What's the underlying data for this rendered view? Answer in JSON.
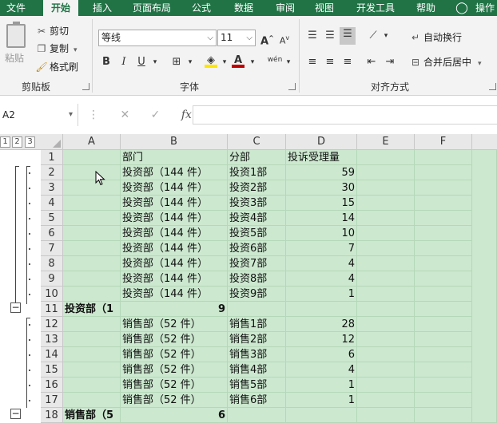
{
  "ribbon_tabs": [
    "文件",
    "开始",
    "插入",
    "页面布局",
    "公式",
    "数据",
    "审阅",
    "视图",
    "开发工具",
    "帮助",
    "操作"
  ],
  "active_tab": "开始",
  "clipboard": {
    "paste_label": "粘贴",
    "cut_label": "剪切",
    "copy_label": "复制",
    "format_painter_label": "格式刷",
    "group_label": "剪贴板"
  },
  "font": {
    "font_name": "等线",
    "font_size": "11",
    "group_label": "字体",
    "bold": "B",
    "italic": "I",
    "underline": "U",
    "grow": "A",
    "shrink": "A",
    "phonetic": "wén"
  },
  "alignment": {
    "wrap_label": "自动换行",
    "merge_label": "合并后居中",
    "group_label": "对齐方式"
  },
  "formula_bar": {
    "name_box": "A2",
    "formula": ""
  },
  "outline_levels": [
    "1",
    "2",
    "3"
  ],
  "columns": [
    "A",
    "B",
    "C",
    "D",
    "E",
    "F"
  ],
  "rows": [
    {
      "num": "1",
      "A": "",
      "B": "部门",
      "C": "分部",
      "D": "投诉受理量",
      "bold": false
    },
    {
      "num": "2",
      "A": "",
      "B": "投资部（144 件）",
      "C": "投资1部",
      "D": "59",
      "bold": false
    },
    {
      "num": "3",
      "A": "",
      "B": "投资部（144 件）",
      "C": "投资2部",
      "D": "30",
      "bold": false
    },
    {
      "num": "4",
      "A": "",
      "B": "投资部（144 件）",
      "C": "投资3部",
      "D": "15",
      "bold": false
    },
    {
      "num": "5",
      "A": "",
      "B": "投资部（144 件）",
      "C": "投资4部",
      "D": "14",
      "bold": false
    },
    {
      "num": "6",
      "A": "",
      "B": "投资部（144 件）",
      "C": "投资5部",
      "D": "10",
      "bold": false
    },
    {
      "num": "7",
      "A": "",
      "B": "投资部（144 件）",
      "C": "投资6部",
      "D": "7",
      "bold": false
    },
    {
      "num": "8",
      "A": "",
      "B": "投资部（144 件）",
      "C": "投资7部",
      "D": "4",
      "bold": false
    },
    {
      "num": "9",
      "A": "",
      "B": "投资部（144 件）",
      "C": "投资8部",
      "D": "4",
      "bold": false
    },
    {
      "num": "10",
      "A": "",
      "B": "投资部（144 件）",
      "C": "投资9部",
      "D": "1",
      "bold": false
    },
    {
      "num": "11",
      "A": "投资部（1",
      "B": "9",
      "C": "",
      "D": "",
      "bold": true
    },
    {
      "num": "12",
      "A": "",
      "B": "销售部（52 件）",
      "C": "销售1部",
      "D": "28",
      "bold": false
    },
    {
      "num": "13",
      "A": "",
      "B": "销售部（52 件）",
      "C": "销售2部",
      "D": "12",
      "bold": false
    },
    {
      "num": "14",
      "A": "",
      "B": "销售部（52 件）",
      "C": "销售3部",
      "D": "6",
      "bold": false
    },
    {
      "num": "15",
      "A": "",
      "B": "销售部（52 件）",
      "C": "销售4部",
      "D": "4",
      "bold": false
    },
    {
      "num": "16",
      "A": "",
      "B": "销售部（52 件）",
      "C": "销售5部",
      "D": "1",
      "bold": false
    },
    {
      "num": "17",
      "A": "",
      "B": "销售部（52 件）",
      "C": "销售6部",
      "D": "1",
      "bold": false
    },
    {
      "num": "18",
      "A": "销售部（5",
      "B": "6",
      "C": "",
      "D": "",
      "bold": true
    }
  ],
  "collapse_symbol": "−",
  "colors": {
    "accent": "#217346",
    "cell_fill": "#cce8cf"
  }
}
